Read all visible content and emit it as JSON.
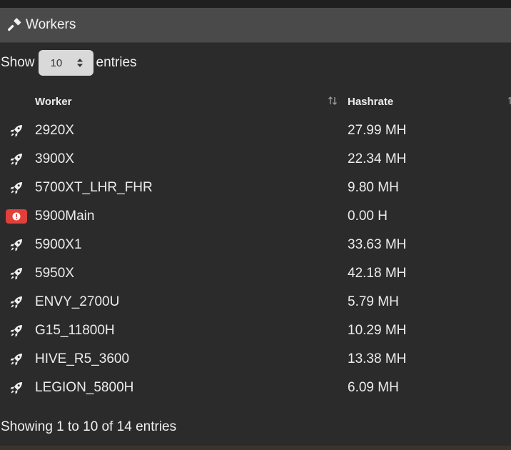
{
  "panel": {
    "title": "Workers",
    "icon": "hammer-icon"
  },
  "length_menu": {
    "prefix": "Show",
    "selected": "10",
    "suffix": "entries"
  },
  "table": {
    "headers": {
      "worker": "Worker",
      "hashrate": "Hashrate"
    },
    "rows": [
      {
        "status": "ok",
        "icon": "rocket-icon",
        "worker": "2920X",
        "hashrate": "27.99 MH"
      },
      {
        "status": "ok",
        "icon": "rocket-icon",
        "worker": "3900X",
        "hashrate": "22.34 MH"
      },
      {
        "status": "ok",
        "icon": "rocket-icon",
        "worker": "5700XT_LHR_FHR",
        "hashrate": "9.80 MH"
      },
      {
        "status": "error",
        "icon": "alert-icon",
        "worker": "5900Main",
        "hashrate": "0.00 H"
      },
      {
        "status": "ok",
        "icon": "rocket-icon",
        "worker": "5900X1",
        "hashrate": "33.63 MH"
      },
      {
        "status": "ok",
        "icon": "rocket-icon",
        "worker": "5950X",
        "hashrate": "42.18 MH"
      },
      {
        "status": "ok",
        "icon": "rocket-icon",
        "worker": "ENVY_2700U",
        "hashrate": "5.79 MH"
      },
      {
        "status": "ok",
        "icon": "rocket-icon",
        "worker": "G15_11800H",
        "hashrate": "10.29 MH"
      },
      {
        "status": "ok",
        "icon": "rocket-icon",
        "worker": "HIVE_R5_3600",
        "hashrate": "13.38 MH"
      },
      {
        "status": "ok",
        "icon": "rocket-icon",
        "worker": "LEGION_5800H",
        "hashrate": "6.09 MH"
      }
    ]
  },
  "footer": {
    "info": "Showing 1 to 10 of 14 entries"
  },
  "colors": {
    "header_bg": "#4a4a4a",
    "body_bg": "#2b2b2b",
    "error": "#e0403a"
  }
}
